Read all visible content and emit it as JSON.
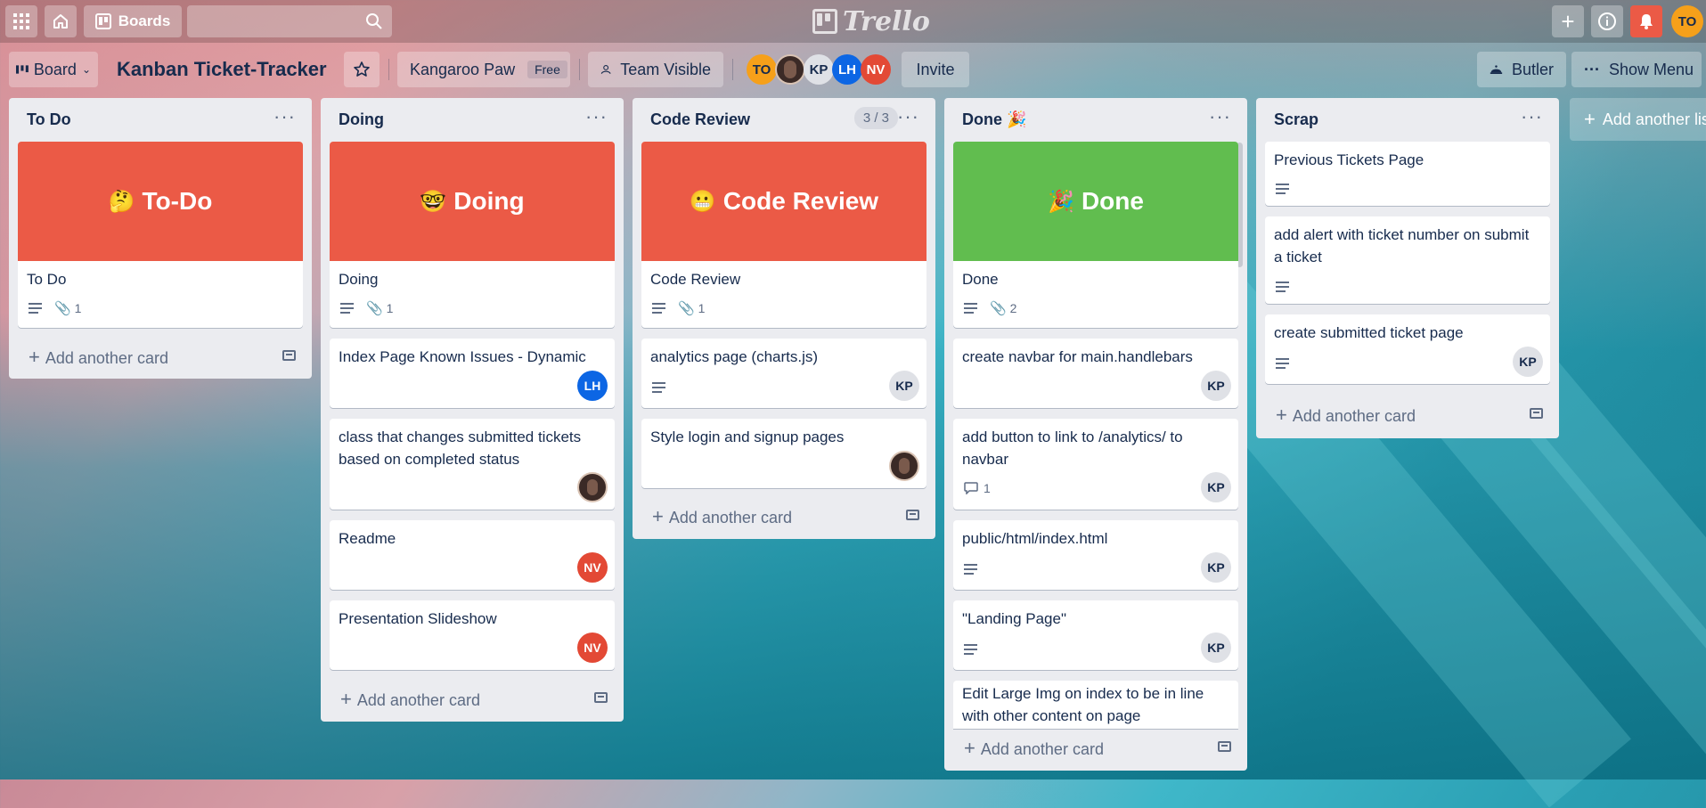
{
  "topbar": {
    "boards_label": "Boards",
    "logo_text": "Trello",
    "user_initials": "TO"
  },
  "board": {
    "view_label": "Board",
    "title": "Kanban Ticket-Tracker",
    "workspace": "Kangaroo Paw",
    "workspace_plan": "Free",
    "visibility": "Team Visible",
    "invite_label": "Invite",
    "butler_label": "Butler",
    "show_menu_label": "Show Menu",
    "members": [
      {
        "initials": "TO",
        "color": "#f6a01a"
      },
      {
        "initials": "",
        "color": "#3b2a26"
      },
      {
        "initials": "KP",
        "color": "#dfe1e6"
      },
      {
        "initials": "LH",
        "color": "#0c66e4"
      },
      {
        "initials": "NV",
        "color": "#e34935"
      }
    ]
  },
  "lists": [
    {
      "title": "To Do",
      "cards": [
        {
          "cover_text": "To-Do",
          "cover_emoji": "🤔",
          "title": "To Do",
          "attachments": "1"
        }
      ],
      "add_card_label": "Add another card"
    },
    {
      "title": "Doing",
      "cards": [
        {
          "cover_text": "Doing",
          "cover_emoji": "🤓",
          "title": "Doing",
          "attachments": "1"
        },
        {
          "title": "Index Page Known Issues - Dynamic",
          "member": "LH"
        },
        {
          "title": "class that changes submitted tickets based on completed status"
        },
        {
          "title": "Readme",
          "member": "NV"
        },
        {
          "title": "Presentation Slideshow",
          "member": "NV"
        }
      ],
      "add_card_label": "Add another card"
    },
    {
      "title": "Code Review",
      "count": "3 / 3",
      "cards": [
        {
          "cover_text": "Code Review",
          "cover_emoji": "😬",
          "title": "Code Review",
          "attachments": "1"
        },
        {
          "title": "analytics page (charts.js)",
          "member": "KP"
        },
        {
          "title": "Style login and signup pages"
        }
      ],
      "add_card_label": "Add another card"
    },
    {
      "title": "Done",
      "title_emoji": "🎉",
      "cards": [
        {
          "cover_text": "Done",
          "cover_emoji": "🎉",
          "title": "Done",
          "attachments": "2"
        },
        {
          "title": "create navbar for main.handlebars",
          "member": "KP"
        },
        {
          "title": "add button to link to /analytics/ to navbar",
          "comments": "1",
          "member": "KP"
        },
        {
          "title": "public/html/index.html",
          "member": "KP"
        },
        {
          "title": "\"Landing Page\"",
          "member": "KP"
        },
        {
          "title": "Edit Large Img on index to be in line with other content on page"
        }
      ],
      "add_card_label": "Add another card"
    },
    {
      "title": "Scrap",
      "cards": [
        {
          "title": "Previous Tickets Page"
        },
        {
          "title": "add alert with ticket number on submit a ticket"
        },
        {
          "title": "create submitted ticket page",
          "member": "KP"
        }
      ],
      "add_card_label": "Add another card"
    }
  ],
  "add_list_label": "Add another list",
  "colors": {
    "cover_red": "#eb5a46",
    "cover_green": "#61bd4f",
    "notification_red": "#eb5a46",
    "avatar_orange": "#f6a01a"
  }
}
